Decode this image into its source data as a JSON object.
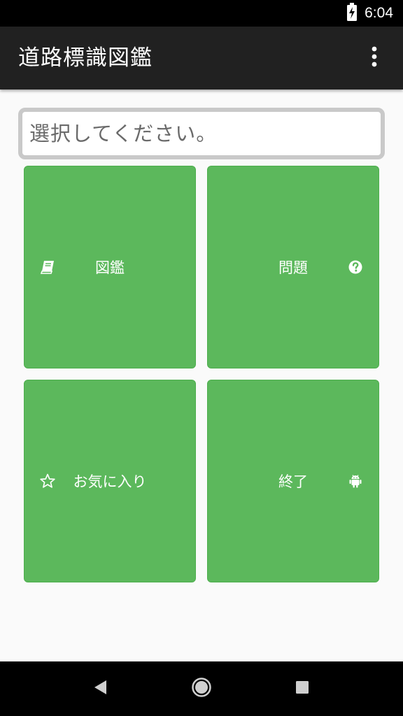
{
  "status_bar": {
    "time": "6:04",
    "icons": [
      "battery-charging-icon"
    ]
  },
  "app_bar": {
    "title": "道路標識図鑑",
    "menu_icon": "more-vert-icon"
  },
  "message": {
    "text": "選択してください。"
  },
  "tiles": [
    {
      "label": "図鑑",
      "icon": "book-icon",
      "icon_side": "left"
    },
    {
      "label": "問題",
      "icon": "question-circle-icon",
      "icon_side": "right"
    },
    {
      "label": "お気に入り",
      "icon": "star-outline-icon",
      "icon_side": "left"
    },
    {
      "label": "終了",
      "icon": "android-icon",
      "icon_side": "right"
    }
  ],
  "nav_bar": {
    "buttons": [
      "back-icon",
      "home-icon",
      "recents-icon"
    ]
  },
  "colors": {
    "tile": "#5cb85c",
    "app_bar": "#212121",
    "background": "#fafafa"
  }
}
